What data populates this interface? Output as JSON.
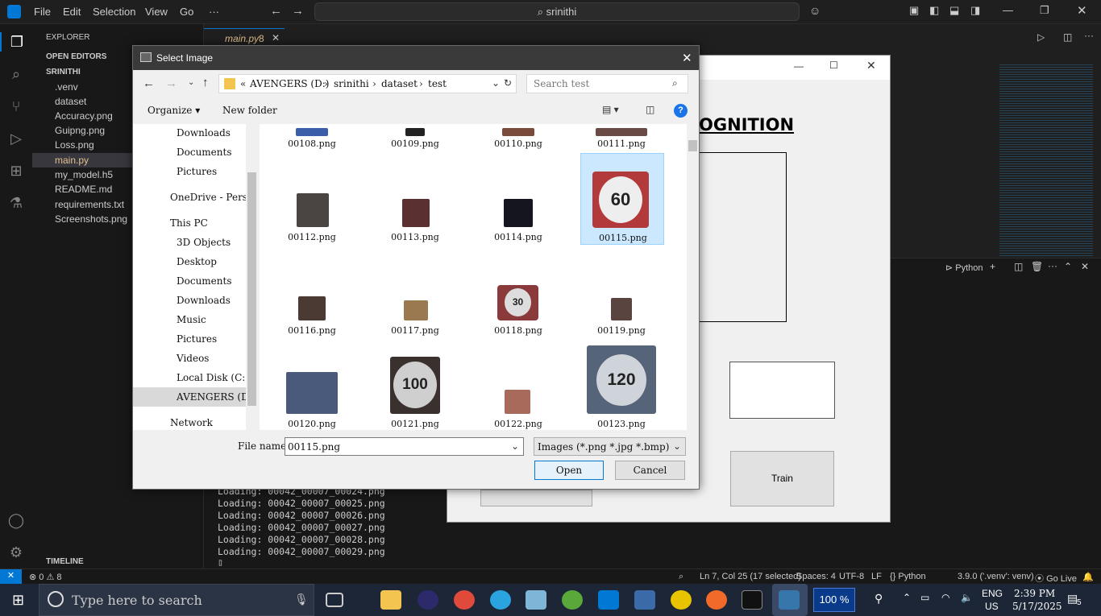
{
  "vscode": {
    "menu": [
      "File",
      "Edit",
      "Selection",
      "View",
      "Go",
      "···"
    ],
    "search": "srinithi",
    "explorer_label": "EXPLORER",
    "open_editors": "OPEN EDITORS",
    "root": "SRINITHI",
    "files": [
      ".venv",
      "dataset",
      "Accuracy.png",
      "Guipng.png",
      "Loss.png",
      "main.py",
      "my_model.h5",
      "README.md",
      "requirements.txt",
      "Screenshots.png"
    ],
    "timeline": "TIMELINE",
    "tab": {
      "name": "main.py",
      "badge": "8"
    },
    "terminal_profile": "Python",
    "terminal_lines": [
      "Loading: 00042_00007_00024.png",
      "Loading: 00042_00007_00025.png",
      "Loading: 00042_00007_00026.png",
      "Loading: 00042_00007_00027.png",
      "Loading: 00042_00007_00028.png",
      "Loading: 00042_00007_00029.png"
    ],
    "status": {
      "errors": "0",
      "warnings": "8",
      "position": "Ln 7, Col 25 (17 selected)",
      "spaces": "Spaces: 4",
      "encoding": "UTF-8",
      "eol": "LF",
      "language": "Python",
      "interpreter": "3.9.0 ('.venv': venv)",
      "golive": "Go Live"
    }
  },
  "tkapp": {
    "heading": "OGNITION",
    "train_button": "Train"
  },
  "dialog": {
    "title": "Select Image",
    "breadcrumb": [
      "AVENGERS (D:)",
      "srinithi",
      "dataset",
      "test"
    ],
    "breadcrumb_prefix": "«",
    "search_placeholder": "Search test",
    "organize": "Organize",
    "new_folder": "New folder",
    "nav": [
      "Downloads",
      "Documents",
      "Pictures",
      "OneDrive - Person",
      "This PC",
      "3D Objects",
      "Desktop",
      "Documents",
      "Downloads",
      "Music",
      "Pictures",
      "Videos",
      "Local Disk (C:)",
      "AVENGERS (D:)",
      "Network"
    ],
    "files": [
      "00108.png",
      "00109.png",
      "00110.png",
      "00111.png",
      "00112.png",
      "00113.png",
      "00114.png",
      "00115.png",
      "00116.png",
      "00117.png",
      "00118.png",
      "00119.png",
      "00120.png",
      "00121.png",
      "00122.png",
      "00123.png"
    ],
    "selected": "00115.png",
    "filename_label": "File name:",
    "filename_value": "00115.png",
    "filetype": "Images (*.png *.jpg *.bmp)",
    "open": "Open",
    "cancel": "Cancel"
  },
  "taskbar": {
    "search_placeholder": "Type here to search",
    "zoom": "100 %",
    "lang1": "ENG",
    "lang2": "US",
    "time": "2:39 PM",
    "date": "5/17/2025",
    "notifications": "5"
  },
  "colors": {
    "accent": "#0078d4",
    "selected_tile": "#cce8ff",
    "vscode_bg": "#1f1f1f"
  }
}
